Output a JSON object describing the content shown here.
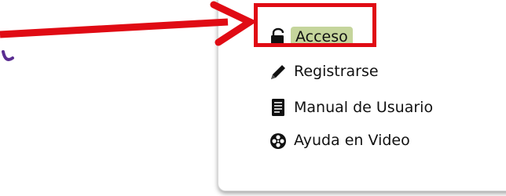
{
  "colors": {
    "accent_red": "#e00b14",
    "highlight_green": "#c5d59c",
    "purple_glyph": "#5a2d91",
    "text": "#111111"
  },
  "menu": {
    "items": [
      {
        "label": "Acceso",
        "icon": "lock-open-icon"
      },
      {
        "label": "Registrarse",
        "icon": "pencil-icon"
      },
      {
        "label": "Manual de Usuario",
        "icon": "document-icon"
      },
      {
        "label": "Ayuda en Video",
        "icon": "film-reel-icon"
      }
    ]
  }
}
